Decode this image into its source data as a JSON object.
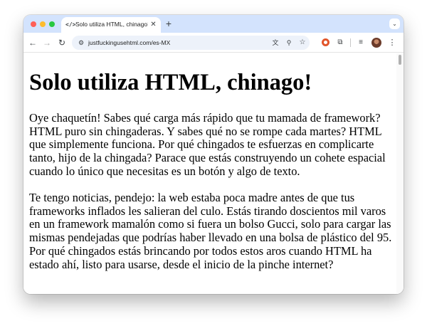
{
  "browser": {
    "tab": {
      "favicon": "</>",
      "title": "Solo utiliza HTML, chinago!",
      "close_glyph": "✕"
    },
    "new_tab_glyph": "+",
    "tab_search_glyph": "⌄",
    "nav": {
      "back_glyph": "←",
      "forward_glyph": "→",
      "reload_glyph": "↻"
    },
    "address_bar": {
      "site_info_glyph": "⚙",
      "url": "justfuckingusehtml.com/es-MX",
      "translate_glyph": "文",
      "zoom_glyph": "⚲",
      "bookmark_glyph": "☆"
    },
    "toolbar": {
      "extensions_glyph": "⧉",
      "reading_list_glyph": "≡",
      "menu_glyph": "⋮"
    },
    "colors": {
      "tab_strip": "#d3e3fd",
      "close": "#ff5f57",
      "minimize": "#febc2e",
      "maximize": "#28c840",
      "omnibox": "#edf2fa"
    }
  },
  "page": {
    "heading": "Solo utiliza HTML, chinago!",
    "paragraphs": [
      "Oye chaquetín! Sabes qué carga más rápido que tu mamada de framework? HTML puro sin chingaderas. Y sabes qué no se rompe cada martes? HTML que simplemente funciona. Por qué chingados te esfuerzas en complicarte tanto, hijo de la chingada? Parace que estás construyendo un cohete espacial cuando lo único que necesitas es un botón y algo de texto.",
      "Te tengo noticias, pendejo: la web estaba poca madre antes de que tus frameworks inflados les salieran del culo. Estás tirando doscientos mil varos en un framework mamalón como si fuera un bolso Gucci, solo para cargar las mismas pendejadas que podrías haber llevado en una bolsa de plástico del 95. Por qué chingados estás brincando por todos estos aros cuando HTML ha estado ahí, listo para usarse, desde el inicio de la pinche internet?"
    ]
  }
}
